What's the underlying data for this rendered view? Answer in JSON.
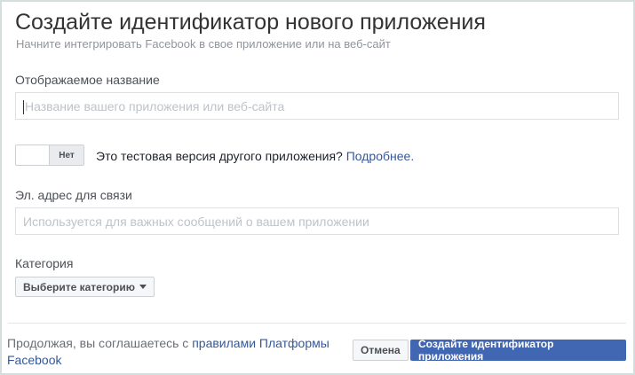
{
  "title": "Создайте идентификатор нового приложения",
  "subtitle": "Начните интегрировать Facebook в свое приложение или на веб-сайт",
  "display_name": {
    "label": "Отображаемое название",
    "placeholder": "Название вашего приложения или веб-сайта"
  },
  "test_toggle": {
    "state_label": "Нет",
    "question": "Это тестовая версия другого приложения?",
    "link": "Подробнее."
  },
  "email": {
    "label": "Эл. адрес для связи",
    "placeholder": "Используется для важных сообщений о вашем приложении"
  },
  "category": {
    "label": "Категория",
    "select": "Выберите категорию"
  },
  "footer": {
    "text": "Продолжая, вы соглашаетесь с",
    "link": "правилами Платформы Facebook"
  },
  "buttons": {
    "cancel": "Отмена",
    "create": "Создайте идентификатор приложения"
  }
}
